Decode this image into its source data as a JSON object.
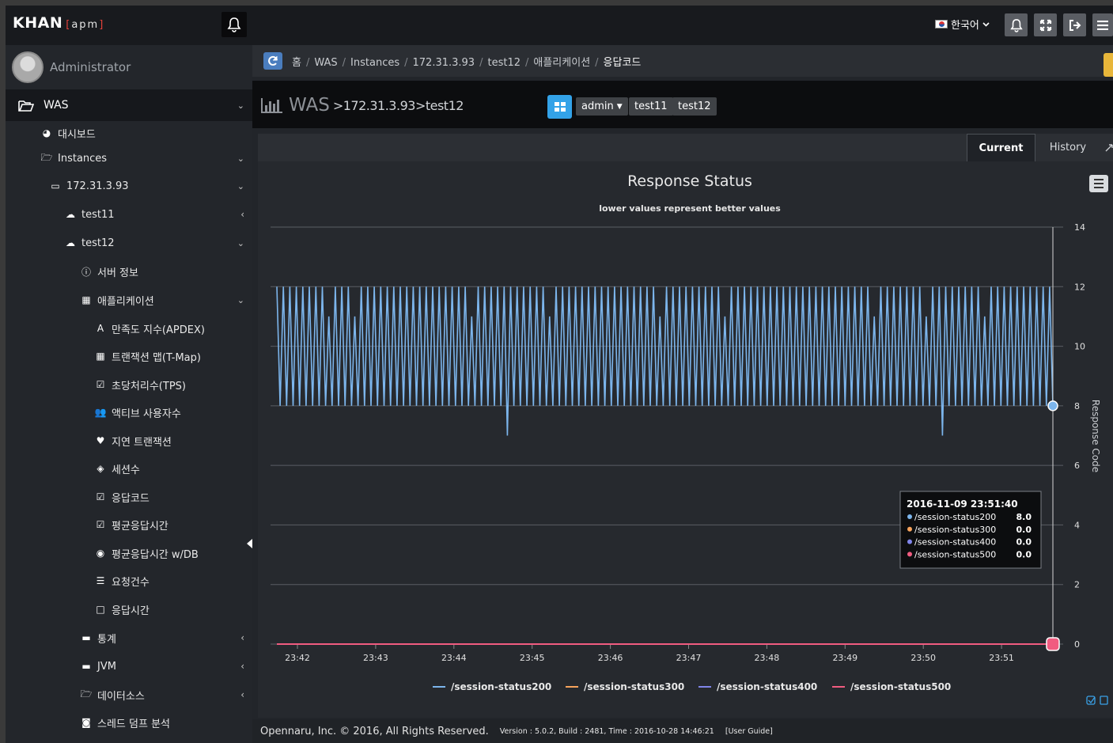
{
  "app": {
    "brand": "KHAN",
    "brand_sub_open": "[",
    "brand_sub": "apm",
    "brand_sub_close": "]"
  },
  "topbar": {
    "language": "한국어"
  },
  "user": {
    "name": "Administrator"
  },
  "sidebar": {
    "top_item": "WAS",
    "items": [
      {
        "label": "대시보드",
        "icon": "dashboard-icon"
      },
      {
        "label": "Instances",
        "icon": "folder-open-icon"
      },
      {
        "label": "172.31.3.93",
        "icon": "monitor-icon"
      },
      {
        "label": "test11",
        "icon": "cloud-upload-icon"
      },
      {
        "label": "test12",
        "icon": "cloud-upload-icon"
      },
      {
        "label": "서버 정보",
        "icon": "info-icon"
      },
      {
        "label": "애플리케이션",
        "icon": "th-large-icon"
      },
      {
        "label": "만족도 지수(APDEX)",
        "icon": "font-icon"
      },
      {
        "label": "트랜잭션 맵(T-Map)",
        "icon": "table-icon"
      },
      {
        "label": "초당처리수(TPS)",
        "icon": "check-square-icon"
      },
      {
        "label": "액티브 사용자수",
        "icon": "users-icon"
      },
      {
        "label": "지연 트랜잭션",
        "icon": "heartbeat-icon"
      },
      {
        "label": "세션수",
        "icon": "ticket-icon"
      },
      {
        "label": "응답코드",
        "icon": "check-square-solid-icon"
      },
      {
        "label": "평균응답시간",
        "icon": "check-square-icon"
      },
      {
        "label": "평균응답시간 w/DB",
        "icon": "dot-circle-icon"
      },
      {
        "label": "요청건수",
        "icon": "list-ol-icon"
      },
      {
        "label": "응답시간",
        "icon": "square-o-icon"
      },
      {
        "label": "통계",
        "icon": "hdd-icon"
      },
      {
        "label": "JVM",
        "icon": "hdd-icon"
      },
      {
        "label": "데이터소스",
        "icon": "folder-open-icon"
      },
      {
        "label": "스레드 덤프 분석",
        "icon": "camera-icon"
      }
    ]
  },
  "breadcrumb": [
    "홈",
    "WAS",
    "Instances",
    "172.31.3.93",
    "test12",
    "애플리케이션",
    "응답코드"
  ],
  "title": {
    "main": "WAS",
    "sep": ">",
    "ip": "172.31.3.93",
    "instance": "test12"
  },
  "chips": {
    "user": "admin",
    "inst1": "test11",
    "inst2": "test12"
  },
  "tabs": {
    "current": "Current",
    "history": "History"
  },
  "tooltip": {
    "time": "2016-11-09 23:51:40",
    "rows": [
      {
        "name": "/session-status200",
        "value": "8.0",
        "color": "#7cb5ec"
      },
      {
        "name": "/session-status300",
        "value": "0.0",
        "color": "#f7a35c"
      },
      {
        "name": "/session-status400",
        "value": "0.0",
        "color": "#8085e9"
      },
      {
        "name": "/session-status500",
        "value": "0.0",
        "color": "#f15c80"
      }
    ]
  },
  "chart_data": {
    "type": "line",
    "title": "Response Status",
    "subtitle": "lower values represent better values",
    "ylabel": "Response Code",
    "ylim": [
      0,
      14
    ],
    "yticks": [
      "0",
      "2",
      "4",
      "6",
      "8",
      "10",
      "12",
      "14"
    ],
    "xticks": [
      "23:42",
      "23:43",
      "23:44",
      "23:45",
      "23:46",
      "23:47",
      "23:48",
      "23:49",
      "23:50",
      "23:51"
    ],
    "grid": true,
    "legend_position": "bottom",
    "series": [
      {
        "name": "/session-status200",
        "color": "#7cb5ec",
        "values": [
          12,
          8,
          12,
          8,
          12,
          8,
          12,
          8,
          12,
          8,
          12,
          8,
          12,
          8,
          12,
          8,
          11,
          8,
          12,
          8,
          12,
          8,
          12,
          8,
          11,
          8,
          12,
          8,
          12,
          8,
          12,
          8,
          12,
          8,
          12,
          8,
          12,
          8,
          12,
          8,
          12,
          8,
          12,
          8,
          12,
          8,
          12,
          8,
          12,
          8,
          12,
          8,
          12,
          8,
          12,
          8,
          12,
          8,
          12,
          8,
          11,
          8,
          12,
          8,
          12,
          8,
          12,
          8,
          12,
          8,
          12,
          7,
          12,
          8,
          12,
          8,
          12,
          8,
          12,
          8,
          12,
          8,
          12,
          8,
          11,
          8,
          12,
          8,
          12,
          8,
          12,
          8,
          12,
          8,
          12,
          8,
          12,
          8,
          12,
          8,
          12,
          8,
          12,
          8,
          12,
          8,
          12,
          8,
          12,
          8,
          12,
          8,
          12,
          8,
          12,
          8,
          12,
          8,
          11,
          8,
          12,
          8,
          12,
          8,
          12,
          8,
          12,
          8,
          12,
          8,
          12,
          8,
          12,
          8,
          12,
          8,
          12,
          8,
          11,
          8,
          12,
          8,
          12,
          8,
          12,
          8,
          12,
          8,
          12,
          8,
          12,
          8,
          12,
          8,
          12,
          8,
          12,
          8,
          12,
          8,
          12,
          8,
          12,
          8,
          12,
          8,
          12,
          8,
          12,
          8,
          12,
          8,
          12,
          8,
          12,
          8,
          12,
          8,
          12,
          8,
          12,
          8,
          12,
          8,
          11,
          8,
          12,
          8,
          12,
          8,
          12,
          8,
          12,
          8,
          12,
          8,
          12,
          8,
          12,
          8,
          11,
          8,
          12,
          8,
          12,
          7,
          12,
          8,
          12,
          8,
          12,
          8,
          12,
          8,
          12,
          8,
          12,
          8,
          11,
          8,
          12,
          8,
          12,
          8,
          12,
          8,
          12,
          8,
          12,
          8,
          12,
          8,
          12,
          8,
          12,
          8,
          12,
          8,
          12,
          8
        ]
      },
      {
        "name": "/session-status300",
        "color": "#f7a35c",
        "values": [
          0,
          0
        ]
      },
      {
        "name": "/session-status400",
        "color": "#8085e9",
        "values": [
          0,
          0
        ]
      },
      {
        "name": "/session-status500",
        "color": "#f15c80",
        "values": [
          0,
          0
        ]
      }
    ]
  },
  "footer": {
    "copyright": "Opennaru, Inc. © 2016, All Rights Reserved.",
    "version": "Version : 5.0.2, Build : 2481, Time : 2016-10-28 14:46:21",
    "guide": "[User Guide]"
  }
}
